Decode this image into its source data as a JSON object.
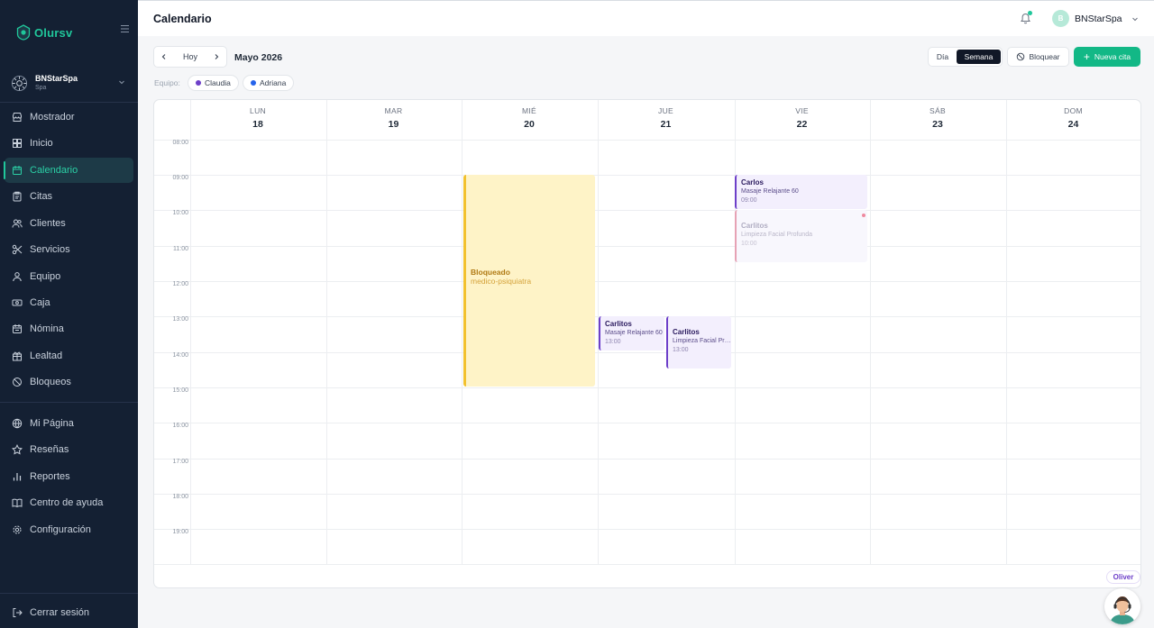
{
  "sidebar": {
    "logo_text": "Olursv",
    "business": {
      "name": "BNStarSpa",
      "type": "Spa"
    },
    "items": [
      {
        "label": "Mostrador",
        "icon": "store-icon"
      },
      {
        "label": "Inicio",
        "icon": "dashboard-icon"
      },
      {
        "label": "Calendario",
        "icon": "calendar-icon",
        "active": true
      },
      {
        "label": "Citas",
        "icon": "clipboard-icon"
      },
      {
        "label": "Clientes",
        "icon": "users-icon"
      },
      {
        "label": "Servicios",
        "icon": "scissors-icon"
      },
      {
        "label": "Equipo",
        "icon": "team-icon"
      },
      {
        "label": "Caja",
        "icon": "cash-icon"
      },
      {
        "label": "Nómina",
        "icon": "payroll-icon"
      },
      {
        "label": "Lealtad",
        "icon": "gift-icon"
      },
      {
        "label": "Bloqueos",
        "icon": "ban-icon"
      }
    ],
    "items2": [
      {
        "label": "Mi Página",
        "icon": "globe-icon"
      },
      {
        "label": "Reseñas",
        "icon": "star-icon"
      },
      {
        "label": "Reportes",
        "icon": "chart-icon"
      },
      {
        "label": "Centro de ayuda",
        "icon": "book-icon"
      },
      {
        "label": "Configuración",
        "icon": "gear-icon"
      }
    ],
    "logout": "Cerrar sesión"
  },
  "header": {
    "title": "Calendario",
    "user_initial": "B",
    "user_name": "BNStarSpa"
  },
  "toolbar": {
    "today": "Hoy",
    "month": "Mayo 2026",
    "view_day": "Día",
    "view_week": "Semana",
    "block": "Bloquear",
    "new": "Nueva cita",
    "team_label": "Equipo:",
    "team": [
      {
        "name": "Claudia",
        "color": "#6d3fc9"
      },
      {
        "name": "Adriana",
        "color": "#2563eb"
      }
    ]
  },
  "calendar": {
    "days": [
      {
        "name": "LUN",
        "num": "18"
      },
      {
        "name": "MAR",
        "num": "19"
      },
      {
        "name": "MIÉ",
        "num": "20"
      },
      {
        "name": "JUE",
        "num": "21"
      },
      {
        "name": "VIE",
        "num": "22"
      },
      {
        "name": "SÁB",
        "num": "23"
      },
      {
        "name": "DOM",
        "num": "24"
      }
    ],
    "hours": [
      "08:00",
      "09:00",
      "10:00",
      "11:00",
      "12:00",
      "13:00",
      "14:00",
      "15:00",
      "16:00",
      "17:00",
      "18:00",
      "19:00"
    ],
    "events": {
      "blocked": {
        "title": "Bloqueado",
        "subtitle": "medico-psiquiatra"
      },
      "carlos": {
        "name": "Carlos",
        "service": "Masaje Relajante 60",
        "time": "09:00"
      },
      "carlitos_fri": {
        "name": "Carlitos",
        "service": "Limpieza Facial Profunda",
        "time": "10:00"
      },
      "carlitos_thu1": {
        "name": "Carlitos",
        "service": "Masaje Relajante 60",
        "time": "13:00"
      },
      "carlitos_thu2": {
        "name": "Carlitos",
        "service": "Limpieza Facial Profunda",
        "time": "13:00"
      }
    }
  },
  "assistant": {
    "label": "Oliver"
  }
}
